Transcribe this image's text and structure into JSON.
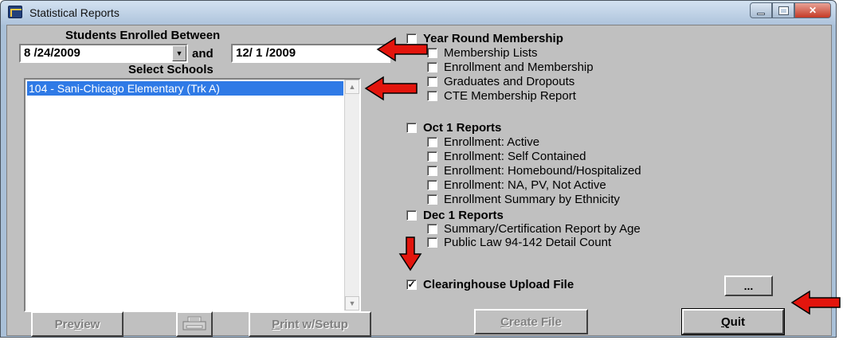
{
  "window": {
    "title": "Statistical Reports"
  },
  "enroll": {
    "heading": "Students Enrolled Between",
    "start_date": "8 /24/2009",
    "and_label": "and",
    "end_date": "12/ 1 /2009"
  },
  "schools": {
    "heading": "Select Schools",
    "items": [
      "104 - Sani-Chicago Elementary (Trk A)"
    ]
  },
  "groups": {
    "year_round": {
      "label": "Year Round Membership",
      "checked": false,
      "items": [
        {
          "label": "Membership Lists",
          "checked": false
        },
        {
          "label": "Enrollment and Membership",
          "checked": false
        },
        {
          "label": "Graduates and Dropouts",
          "checked": false
        },
        {
          "label": "CTE Membership Report",
          "checked": false
        }
      ]
    },
    "oct1": {
      "label": "Oct 1 Reports",
      "checked": false,
      "items": [
        {
          "label": "Enrollment: Active",
          "checked": false
        },
        {
          "label": "Enrollment: Self Contained",
          "checked": false
        },
        {
          "label": "Enrollment: Homebound/Hospitalized",
          "checked": false
        },
        {
          "label": "Enrollment: NA, PV, Not Active",
          "checked": false
        },
        {
          "label": "Enrollment Summary by Ethnicity",
          "checked": false
        }
      ]
    },
    "dec1": {
      "label": "Dec 1 Reports",
      "checked": false,
      "items": [
        {
          "label": "Summary/Certification Report by Age",
          "checked": false
        },
        {
          "label": "Public Law 94-142 Detail Count",
          "checked": false
        }
      ]
    },
    "clearinghouse": {
      "label": "Clearinghouse Upload File",
      "checked": true,
      "browse_label": "..."
    }
  },
  "buttons": {
    "preview_pre": "Pre",
    "preview_key": "v",
    "preview_post": "iew",
    "print_setup_key": "P",
    "print_setup_post": "rint w/Setup",
    "create_file_key": "C",
    "create_file_post": "reate File",
    "quit_key": "Q",
    "quit_post": "uit"
  },
  "colors": {
    "arrow": "#e3150d",
    "selection": "#2f7ae6",
    "face": "#c0c0c0"
  }
}
